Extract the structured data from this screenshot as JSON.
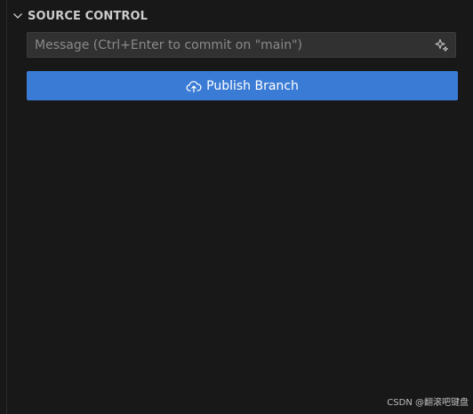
{
  "section": {
    "title": "SOURCE CONTROL",
    "chevron_icon": "chevron-down-icon"
  },
  "commit": {
    "placeholder": "Message (Ctrl+Enter to commit on \"main\")",
    "value": "",
    "sparkle_icon": "sparkle-icon"
  },
  "publish": {
    "label": "Publish Branch",
    "icon": "cloud-upload-icon"
  },
  "watermark": "CSDN @翻滚吧键盘",
  "colors": {
    "background": "#181818",
    "button": "#3a7bd5",
    "input_bg": "#313131",
    "text": "#cccccc"
  }
}
